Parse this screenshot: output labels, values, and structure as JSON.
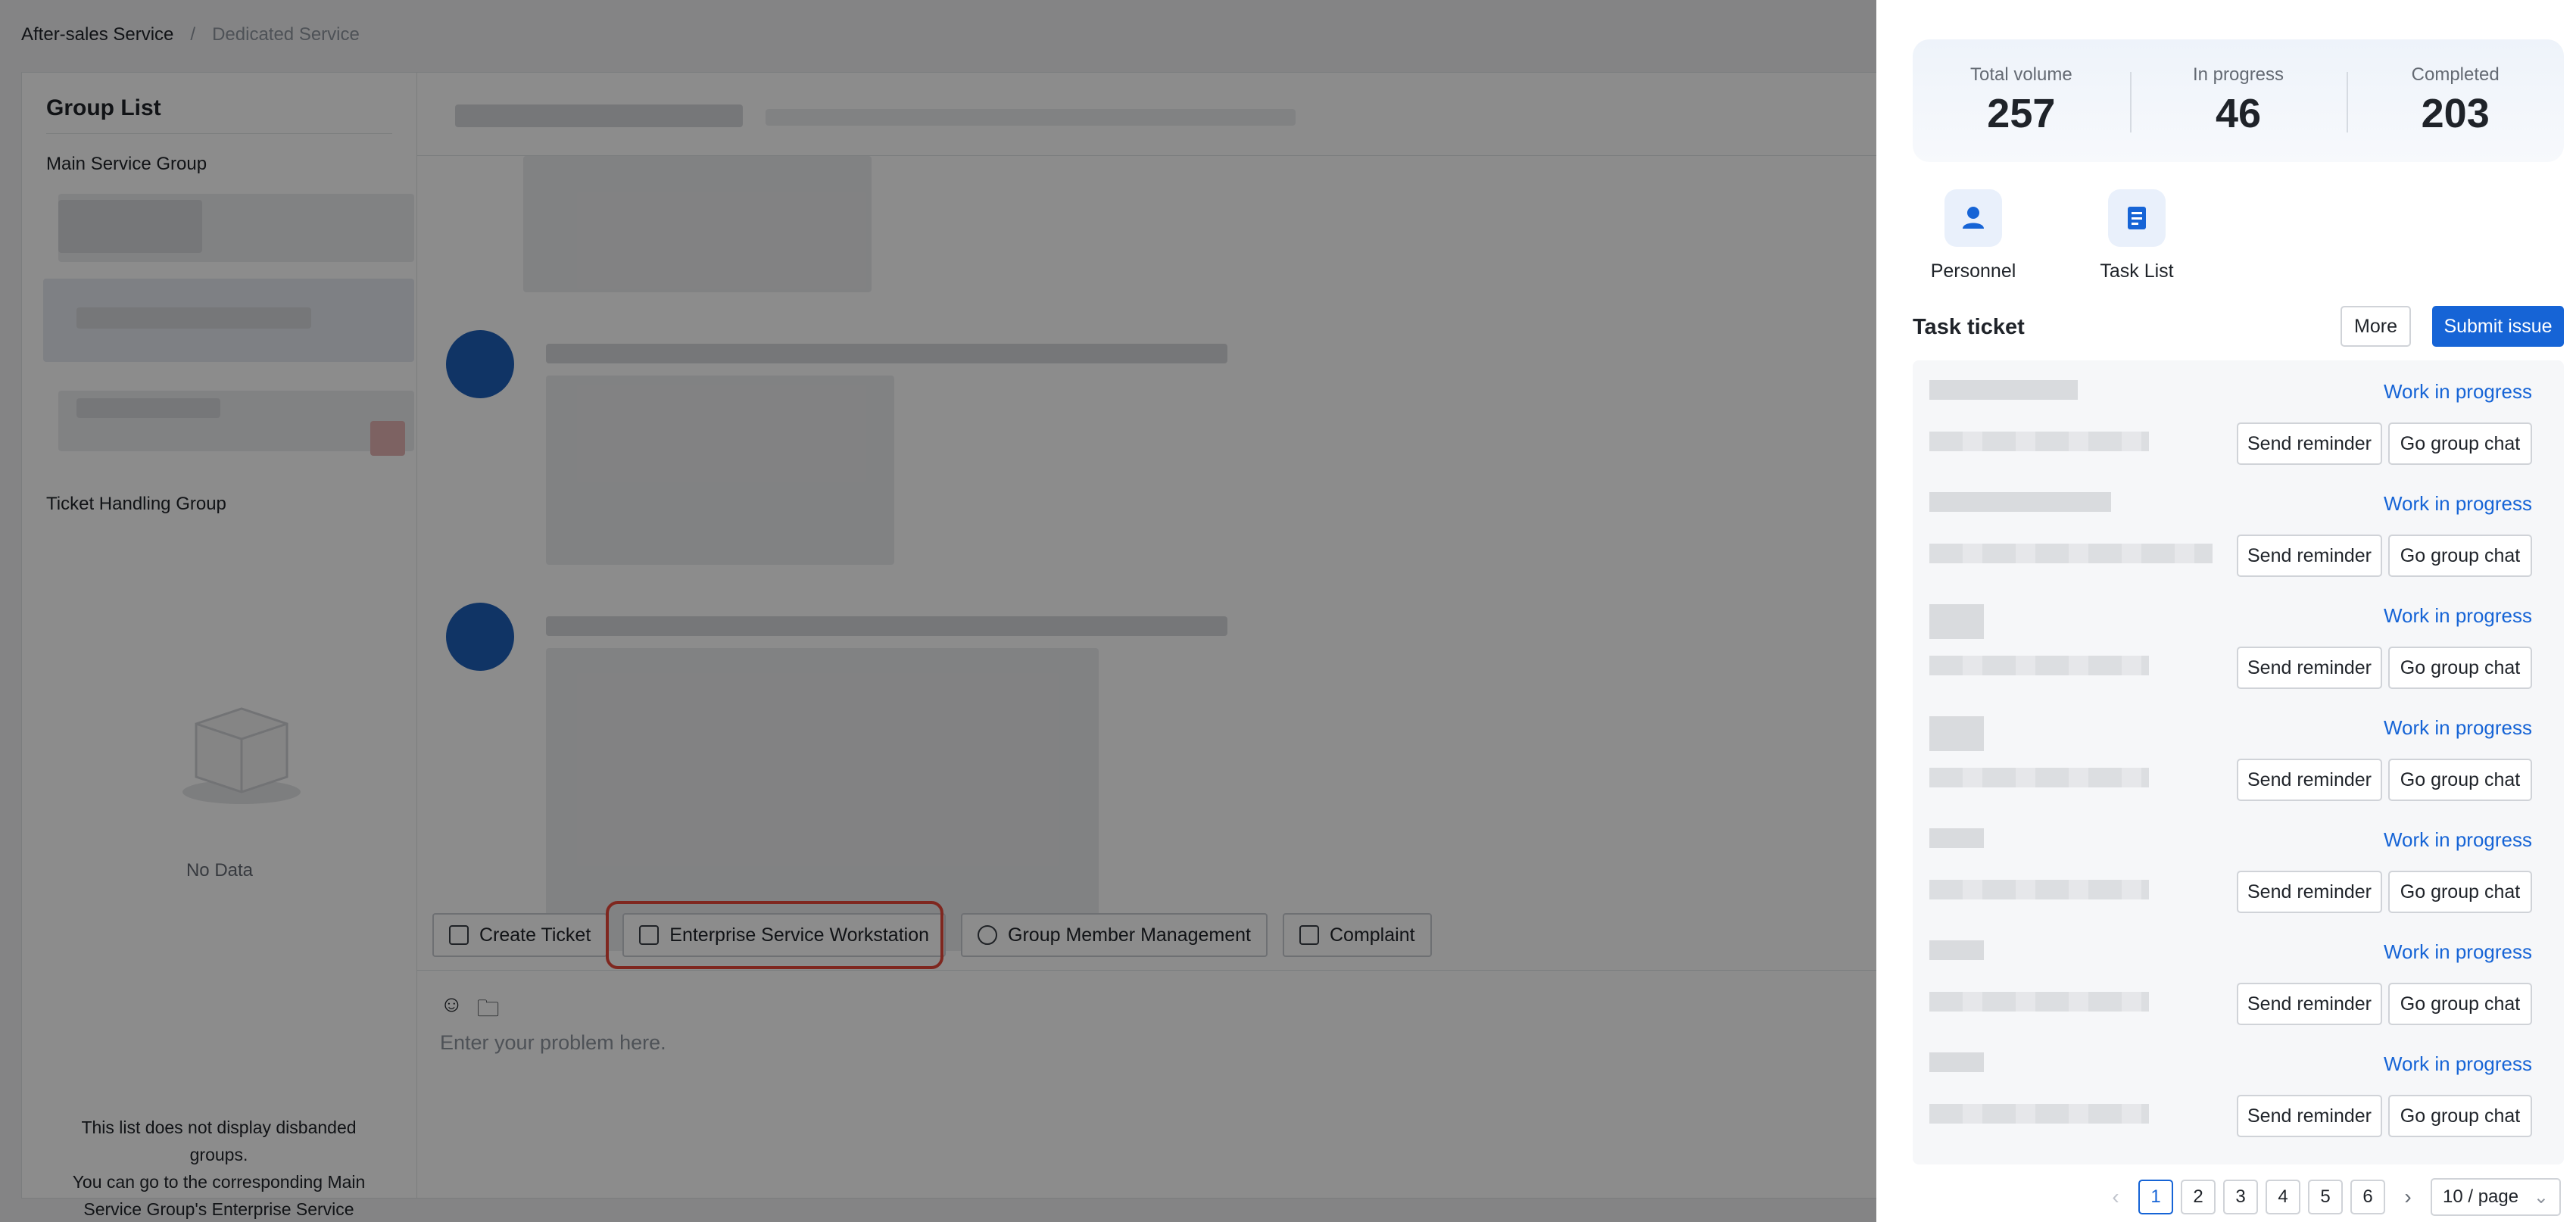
{
  "breadcrumb": {
    "parent": "After-sales Service",
    "separator": "/",
    "current": "Dedicated Service"
  },
  "group_panel": {
    "title": "Group List",
    "main_group_label": "Main Service Group",
    "ticket_group_label": "Ticket Handling Group",
    "empty_text": "No Data",
    "note": "This list does not display disbanded groups.\nYou can go to the corresponding Main Service Group's Enterprise Service Workstation to view them."
  },
  "actions": {
    "create_ticket": "Create Ticket",
    "workstation": "Enterprise Service Workstation",
    "member_mgmt": "Group Member Management",
    "complaint": "Complaint"
  },
  "composer": {
    "placeholder": "Enter your problem here."
  },
  "stats": {
    "total_label": "Total volume",
    "total_value": "257",
    "progress_label": "In progress",
    "progress_value": "46",
    "completed_label": "Completed",
    "completed_value": "203"
  },
  "shortcuts": {
    "personnel": "Personnel",
    "task_list": "Task List"
  },
  "tickets": {
    "title": "Task ticket",
    "more": "More",
    "submit": "Submit issue",
    "items": [
      {
        "status": "Work in progress",
        "remind": "Send reminder",
        "chat": "Go group chat"
      },
      {
        "status": "Work in progress",
        "remind": "Send reminder",
        "chat": "Go group chat"
      },
      {
        "status": "Work in progress",
        "remind": "Send reminder",
        "chat": "Go group chat"
      },
      {
        "status": "Work in progress",
        "remind": "Send reminder",
        "chat": "Go group chat"
      },
      {
        "status": "Work in progress",
        "remind": "Send reminder",
        "chat": "Go group chat"
      },
      {
        "status": "Work in progress",
        "remind": "Send reminder",
        "chat": "Go group chat"
      },
      {
        "status": "Work in progress",
        "remind": "Send reminder",
        "chat": "Go group chat"
      }
    ]
  },
  "pagination": {
    "pages": [
      "1",
      "2",
      "3",
      "4",
      "5",
      "6"
    ],
    "current": "1",
    "page_size": "10 / page"
  },
  "colors": {
    "accent": "#1664d6",
    "highlight": "#e8483a",
    "overlay": "rgba(0,0,0,0.45)"
  }
}
